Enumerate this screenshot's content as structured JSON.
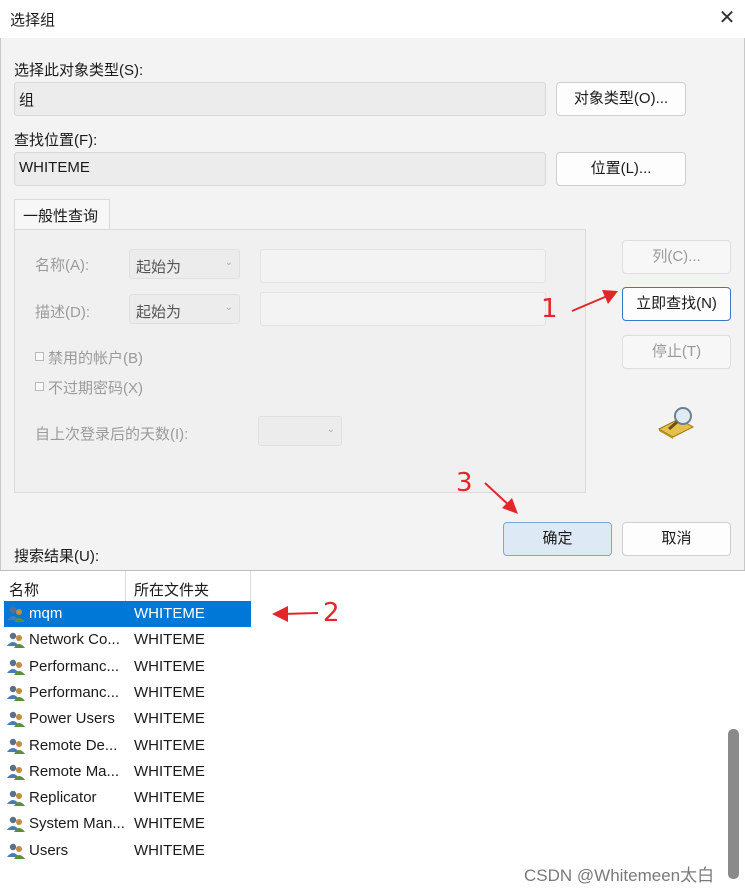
{
  "window": {
    "title": "选择组",
    "close_label": "✕"
  },
  "object_type": {
    "label": "选择此对象类型(S):",
    "value": "组",
    "button": "对象类型(O)..."
  },
  "location": {
    "label": "查找位置(F):",
    "value": "WHITEME",
    "button": "位置(L)..."
  },
  "query": {
    "tab": "一般性查询",
    "name_label": "名称(A):",
    "name_mode": "起始为",
    "desc_label": "描述(D):",
    "desc_mode": "起始为",
    "disabled_accounts": "禁用的帐户(B)",
    "no_expire_pw": "不过期密码(X)",
    "days_label": "自上次登录后的天数(I):"
  },
  "side_buttons": {
    "columns": "列(C)...",
    "find_now": "立即查找(N)",
    "stop": "停止(T)"
  },
  "actions": {
    "ok": "确定",
    "cancel": "取消"
  },
  "results": {
    "label": "搜索结果(U):",
    "columns": [
      "名称",
      "所在文件夹"
    ],
    "rows": [
      {
        "name": "mqm",
        "folder": "WHITEME",
        "selected": true
      },
      {
        "name": "Network Co...",
        "folder": "WHITEME"
      },
      {
        "name": "Performanc...",
        "folder": "WHITEME"
      },
      {
        "name": "Performanc...",
        "folder": "WHITEME"
      },
      {
        "name": "Power Users",
        "folder": "WHITEME"
      },
      {
        "name": "Remote De...",
        "folder": "WHITEME"
      },
      {
        "name": "Remote Ma...",
        "folder": "WHITEME"
      },
      {
        "name": "Replicator",
        "folder": "WHITEME"
      },
      {
        "name": "System Man...",
        "folder": "WHITEME"
      },
      {
        "name": "Users",
        "folder": "WHITEME"
      }
    ]
  },
  "annotations": {
    "a1": "1",
    "a2": "2",
    "a3": "3"
  },
  "watermark": "CSDN @Whitemeen太白",
  "colors": {
    "selection": "#0078d7",
    "annotation": "#e3262a",
    "primary_button": "#dde9f5"
  },
  "icons": {
    "group": "users-group-icon",
    "search": "magnifier-search-icon"
  }
}
